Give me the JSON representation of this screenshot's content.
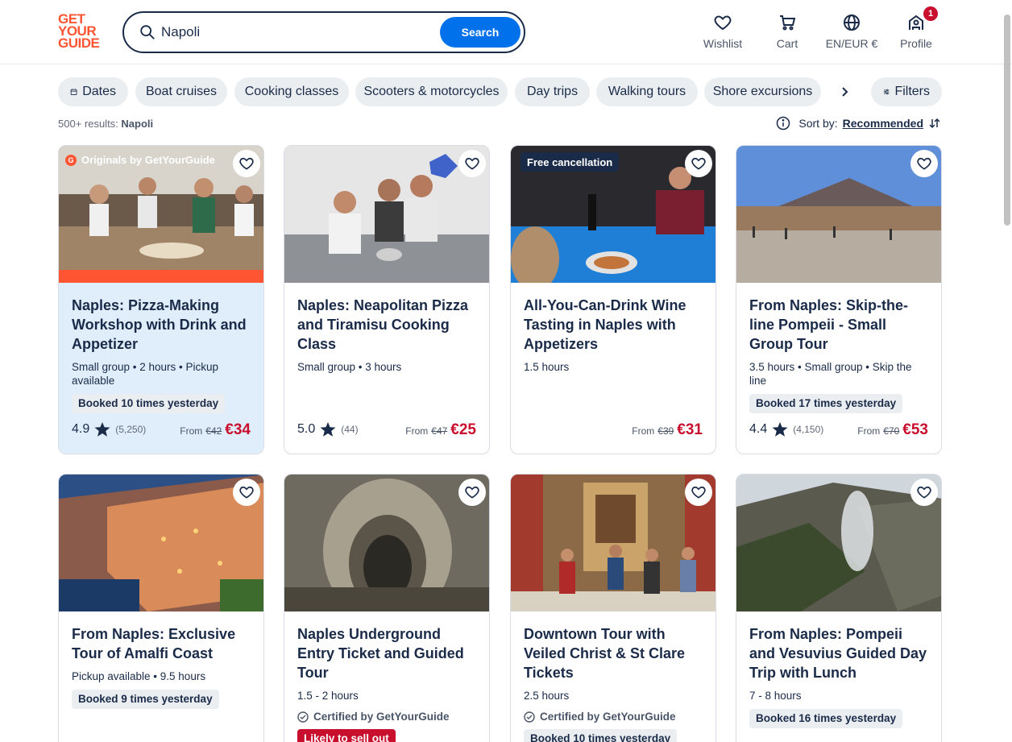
{
  "header": {
    "logo": [
      "GET",
      "YOUR",
      "GUIDE"
    ],
    "search_value": "Napoli",
    "search_button": "Search",
    "nav": [
      {
        "label": "Wishlist",
        "icon": "heart-icon"
      },
      {
        "label": "Cart",
        "icon": "cart-icon"
      },
      {
        "label": "EN/EUR €",
        "icon": "globe-icon"
      },
      {
        "label": "Profile",
        "icon": "profile-icon",
        "badge": "1"
      }
    ]
  },
  "chips": [
    "Dates",
    "Boat cruises",
    "Cooking classes",
    "Scooters & motorcycles",
    "Day trips",
    "Walking tours",
    "Shore excursions"
  ],
  "filters_label": "Filters",
  "results": {
    "count": "500+ results:",
    "query": "Napoli"
  },
  "sort": {
    "label": "Sort by:",
    "value": "Recommended"
  },
  "colors": {
    "brand": "#ff5533",
    "accent": "#0071eb",
    "price": "#c8102e",
    "text": "#1a2b49"
  },
  "cards": [
    {
      "title": "Naples: Pizza-Making Workshop with Drink and Appetizer",
      "meta": "Small group • 2 hours • Pickup available",
      "booked": "Booked 10 times yesterday",
      "rating": "4.9",
      "reviews": "(5,250)",
      "from": "From",
      "old_price": "€42",
      "price": "€34",
      "top_tag": "Originals by GetYourGuide"
    },
    {
      "title": "Naples: Neapolitan Pizza and Tiramisu Cooking Class",
      "meta": "Small group • 3 hours",
      "rating": "5.0",
      "reviews": "(44)",
      "from": "From",
      "old_price": "€47",
      "price": "€25"
    },
    {
      "title": "All-You-Can-Drink Wine Tasting in Naples with Appetizers",
      "meta": "1.5 hours",
      "from": "From",
      "old_price": "€39",
      "price": "€31",
      "top_tag": "Free cancellation"
    },
    {
      "title": "From Naples: Skip-the-line Pompeii - Small Group Tour",
      "meta": "3.5 hours • Small group • Skip the line",
      "booked": "Booked 17 times yesterday",
      "rating": "4.4",
      "reviews": "(4,150)",
      "from": "From",
      "old_price": "€70",
      "price": "€53"
    },
    {
      "title": "From Naples: Exclusive Tour of Amalfi Coast",
      "meta": "Pickup available • 9.5 hours",
      "booked": "Booked 9 times yesterday"
    },
    {
      "title": "Naples Underground Entry Ticket and Guided Tour",
      "meta": "1.5 - 2 hours",
      "certified": "Certified by GetYourGuide",
      "sellout": "Likely to sell out"
    },
    {
      "title": "Downtown Tour with Veiled Christ & St Clare Tickets",
      "meta": "2.5 hours",
      "certified": "Certified by GetYourGuide",
      "booked": "Booked 10 times yesterday"
    },
    {
      "title": "From Naples: Pompeii and Vesuvius Guided Day Trip with Lunch",
      "meta": "7 - 8 hours",
      "booked": "Booked 16 times yesterday"
    }
  ]
}
